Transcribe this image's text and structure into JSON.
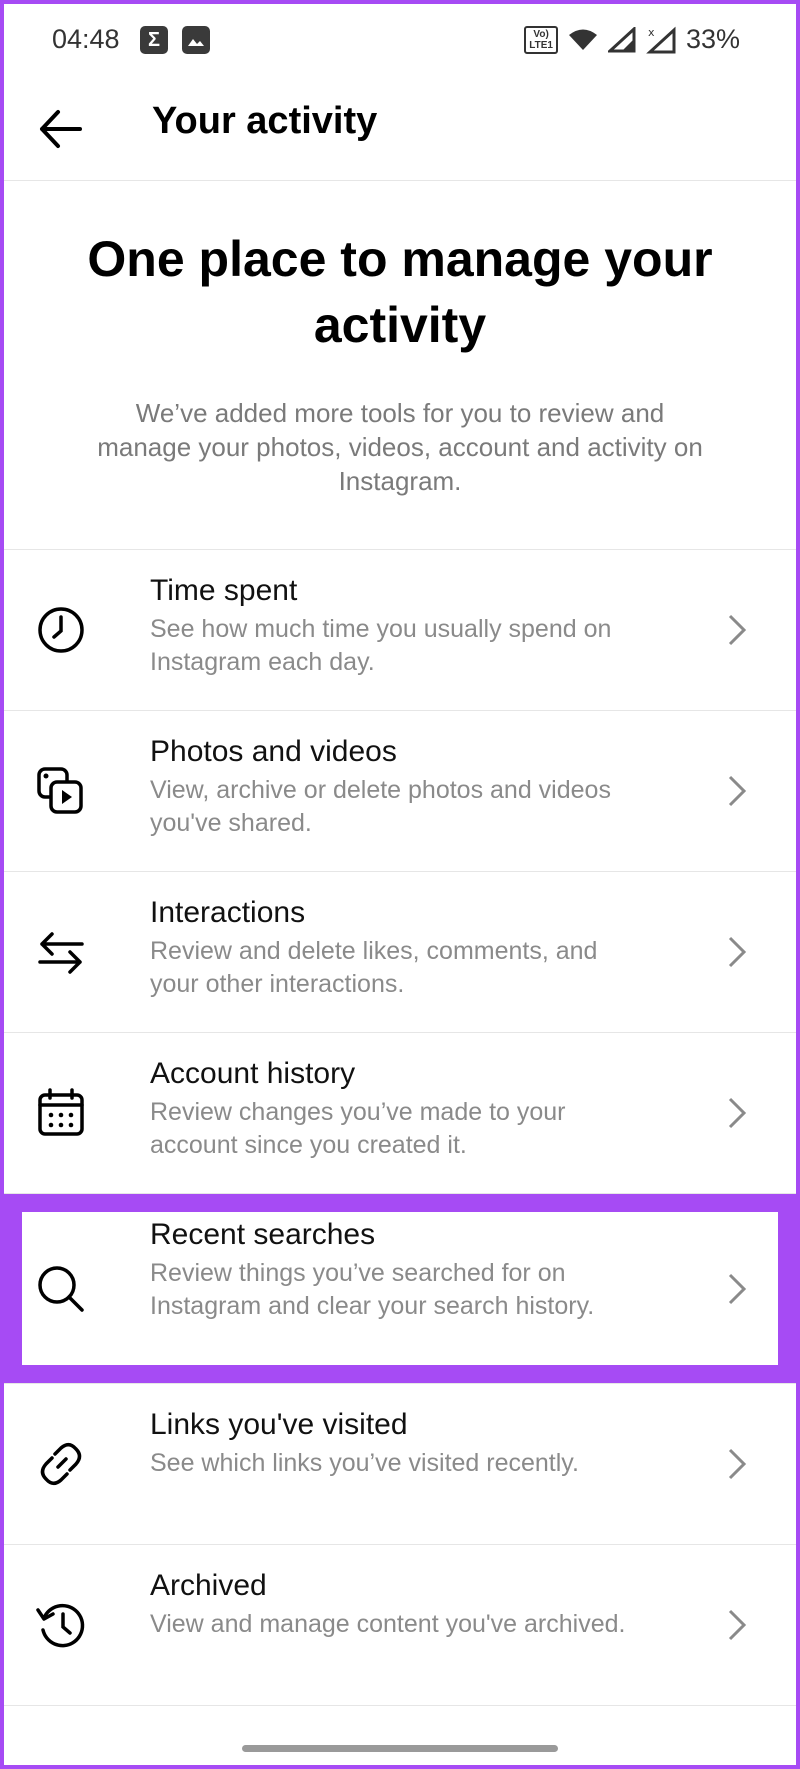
{
  "status_bar": {
    "time": "04:48",
    "volte": "Vo) LTE1",
    "battery": "33%"
  },
  "header": {
    "title": "Your activity"
  },
  "hero": {
    "title": "One place to manage your activity",
    "subtitle": "We’ve added more tools for you to review and manage your photos, videos, account and activity on Instagram."
  },
  "menu": [
    {
      "icon": "clock-icon",
      "label": "Time spent",
      "desc": "See how much time you usually spend on Instagram each day."
    },
    {
      "icon": "photos-videos-icon",
      "label": "Photos and videos",
      "desc": "View, archive or delete photos and videos you've shared."
    },
    {
      "icon": "interactions-arrows-icon",
      "label": "Interactions",
      "desc": "Review and delete likes, comments, and your other interactions."
    },
    {
      "icon": "calendar-icon",
      "label": "Account history",
      "desc": "Review changes you’ve made to your account since you created it."
    },
    {
      "icon": "search-icon",
      "label": "Recent searches",
      "desc": "Review things you’ve searched for on Instagram and clear your search history."
    },
    {
      "icon": "link-icon",
      "label": "Links you've visited",
      "desc": "See which links you’ve visited recently."
    },
    {
      "icon": "archive-history-icon",
      "label": "Archived",
      "desc": "View and manage content you've archived."
    }
  ],
  "highlight_color": "#a64bf4"
}
